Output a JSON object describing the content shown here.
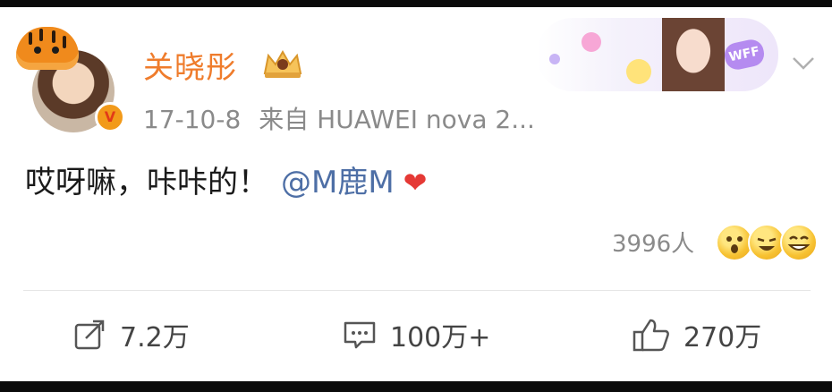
{
  "post": {
    "username": "关晓彤",
    "date": "17-10-8",
    "source": "来自 HUAWEI nova 2...",
    "text": "哎呀嘛，咔咔的！",
    "mention": "@M鹿M",
    "heart": "❤",
    "reaction_count": "3996人"
  },
  "actions": {
    "repost": "7.2万",
    "comment": "100万+",
    "like": "270万"
  },
  "badge": {
    "verified": "V"
  },
  "banner": {
    "tag": "WFF"
  },
  "colors": {
    "username": "#ef7c2c",
    "mention": "#4e6fa6",
    "heart": "#e53935",
    "meta": "#8a8a8a",
    "verified_badge": "#f29a1a"
  },
  "icons": [
    "tiger-avatar-frame-icon",
    "vip-crown-icon",
    "chevron-down-icon",
    "share-icon",
    "comment-icon",
    "thumbs-up-icon"
  ]
}
